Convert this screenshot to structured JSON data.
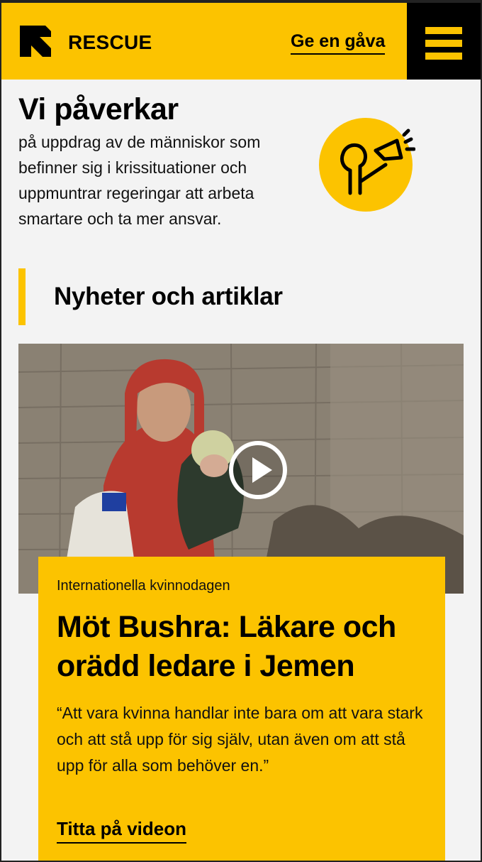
{
  "header": {
    "logo_text": "RESCUE",
    "donate_label": "Ge en gåva",
    "brand_color": "#fcc300",
    "menu_icon": "hamburger-icon"
  },
  "advocacy": {
    "title": "Vi påverkar",
    "text": "på uppdrag av de människor som befinner sig i krissituationer och uppmuntrar regeringar att arbeta smartare och ta mer ansvar.",
    "icon": "megaphone-person-icon"
  },
  "news": {
    "section_title": "Nyheter och artiklar",
    "featured": {
      "image": "woman-holding-baby-photo",
      "kicker": "Internationella kvinnodagen",
      "title": "Möt Bushra: Läkare och orädd ledare i Jemen",
      "quote": "“Att vara kvinna handlar inte bara om att vara stark och att stå upp för sig själv, utan även om att stå upp för alla som behöver en.”",
      "cta_label": "Titta på videon"
    }
  }
}
